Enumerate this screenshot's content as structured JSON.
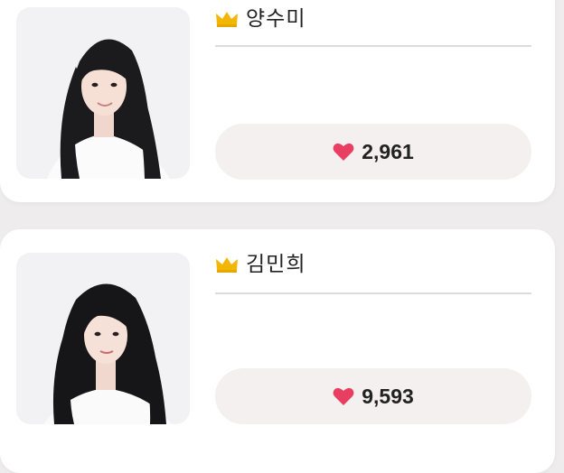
{
  "colors": {
    "crown": "#f2b705",
    "heart": "#e83e62",
    "button_bg": "#f4f0ef",
    "card_bg": "#ffffff",
    "page_bg": "#eeecec"
  },
  "contestants": [
    {
      "name": "양수미",
      "votes": "2,961",
      "icon": "crown-icon",
      "vote_icon": "heart-icon"
    },
    {
      "name": "김민희",
      "votes": "9,593",
      "icon": "crown-icon",
      "vote_icon": "heart-icon"
    }
  ]
}
